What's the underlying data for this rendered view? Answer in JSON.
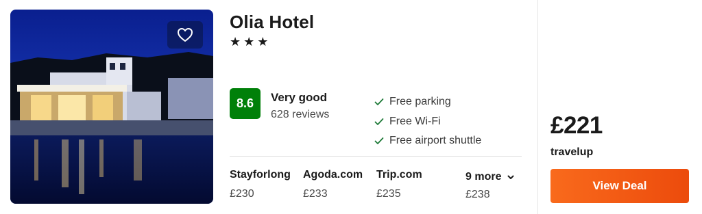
{
  "hotel": {
    "name": "Olia Hotel",
    "stars_text": "★★★",
    "star_count": 3
  },
  "rating": {
    "score": "8.6",
    "label": "Very good",
    "reviews": "628 reviews",
    "badge_color": "#008009"
  },
  "amenities": [
    "Free parking",
    "Free Wi-Fi",
    "Free airport shuttle"
  ],
  "providers": [
    {
      "name": "Stayforlong",
      "price": "£230"
    },
    {
      "name": "Agoda.com",
      "price": "£233"
    },
    {
      "name": "Trip.com",
      "price": "£235"
    }
  ],
  "more": {
    "label": "9 more",
    "price": "£238"
  },
  "deal": {
    "price": "£221",
    "provider": "travelup",
    "button_label": "View Deal",
    "button_color": "#f15a14"
  },
  "icons": {
    "favorite": "heart-outline-icon",
    "amenity": "checkmark-icon",
    "more": "chevron-down-icon"
  }
}
